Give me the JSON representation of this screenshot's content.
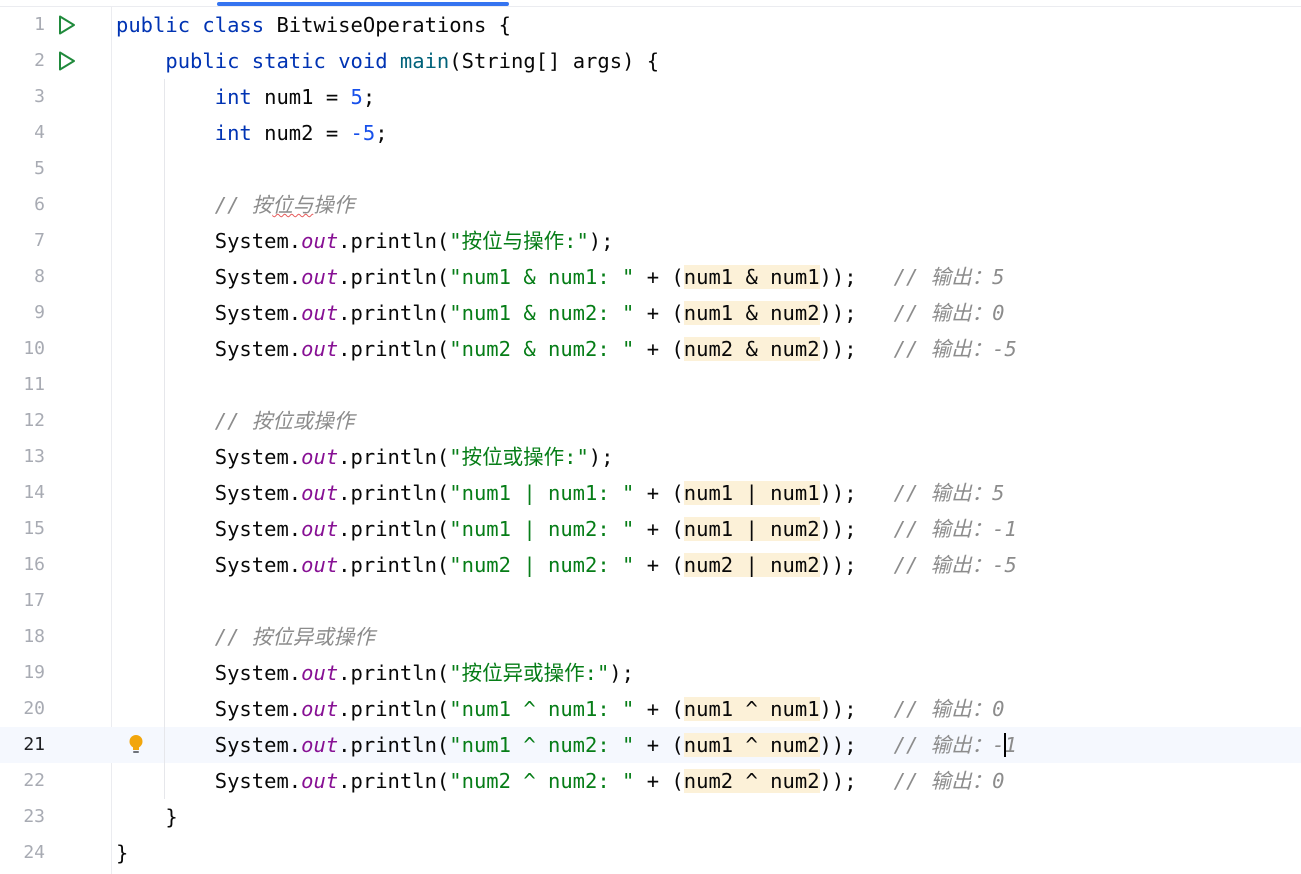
{
  "editor": {
    "current_line": 21,
    "lines": [
      {
        "n": "1",
        "t": "public class BitwiseOperations {"
      },
      {
        "n": "2",
        "t": "    public static void main(String[] args) {"
      },
      {
        "n": "3",
        "t": "        int num1 = 5;"
      },
      {
        "n": "4",
        "t": "        int num2 = -5;"
      },
      {
        "n": "5",
        "t": ""
      },
      {
        "n": "6",
        "t": "        // 按位与操作"
      },
      {
        "n": "7",
        "t": "        System.out.println(\"按位与操作:\");"
      },
      {
        "n": "8",
        "t": "        System.out.println(\"num1 & num1: \" + (num1 & num1));   // 输出：5"
      },
      {
        "n": "9",
        "t": "        System.out.println(\"num1 & num2: \" + (num1 & num2));   // 输出：0"
      },
      {
        "n": "10",
        "t": "        System.out.println(\"num2 & num2: \" + (num2 & num2));   // 输出：-5"
      },
      {
        "n": "11",
        "t": ""
      },
      {
        "n": "12",
        "t": "        // 按位或操作"
      },
      {
        "n": "13",
        "t": "        System.out.println(\"按位或操作:\");"
      },
      {
        "n": "14",
        "t": "        System.out.println(\"num1 | num1: \" + (num1 | num1));   // 输出：5"
      },
      {
        "n": "15",
        "t": "        System.out.println(\"num1 | num2: \" + (num1 | num2));   // 输出：-1"
      },
      {
        "n": "16",
        "t": "        System.out.println(\"num2 | num2: \" + (num2 | num2));   // 输出：-5"
      },
      {
        "n": "17",
        "t": ""
      },
      {
        "n": "18",
        "t": "        // 按位异或操作"
      },
      {
        "n": "19",
        "t": "        System.out.println(\"按位异或操作:\");"
      },
      {
        "n": "20",
        "t": "        System.out.println(\"num1 ^ num1: \" + (num1 ^ num1));   // 输出：0"
      },
      {
        "n": "21",
        "t": "        System.out.println(\"num1 ^ num2: \" + (num1 ^ num2));   // 输出：-1"
      },
      {
        "n": "22",
        "t": "        System.out.println(\"num2 ^ num2: \" + (num2 ^ num2));   // 输出：0"
      },
      {
        "n": "23",
        "t": "    }"
      },
      {
        "n": "24",
        "t": "}"
      }
    ],
    "gutter_icons": {
      "run_lines": [
        1,
        2
      ],
      "intention_line": 21
    },
    "colors": {
      "keyword": "#0033b3",
      "number": "#1750eb",
      "string": "#067d17",
      "comment": "#8c8c8c",
      "static_field": "#871094",
      "method_decl": "#00627a",
      "text": "#080808",
      "usage_highlight": "#fcf1d8",
      "current_line": "#f5f8fe",
      "run_icon": "#208a3c",
      "bulb_icon": "#f2a60c"
    },
    "icons": {
      "run": "run-gutter-icon",
      "intention": "lightbulb-icon"
    }
  }
}
